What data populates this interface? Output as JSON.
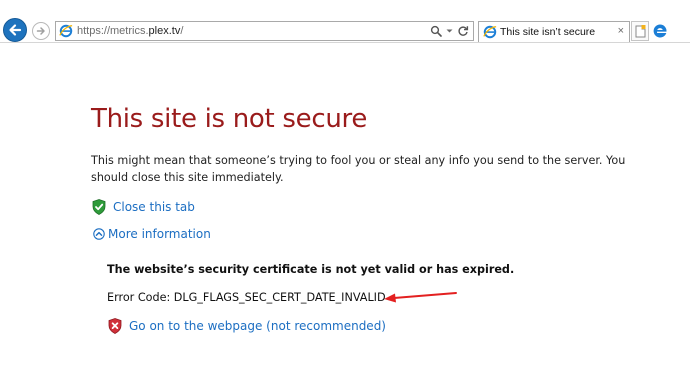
{
  "browser": {
    "url": "https://metrics.plex.tv/",
    "url_host": "plex.tv",
    "url_prefix": "https://metrics.",
    "url_suffix": "/",
    "tab_title": "This site isn’t secure",
    "tab_close_glyph": "×"
  },
  "page": {
    "title": "This site is not secure",
    "description": "This might mean that someone’s trying to fool you or steal any info you send to the server. You should close this site immediately.",
    "close_tab_label": "Close this tab",
    "more_info_label": "More information",
    "cert_heading": "The website’s security certificate is not yet valid or has expired.",
    "error_code_text": "Error Code: DLG_FLAGS_SEC_CERT_DATE_INVALID",
    "go_on_label": "Go on to the webpage (not recommended)"
  },
  "colors": {
    "title": "#9a1b1b",
    "link": "#1c6ec2",
    "annotation_arrow": "#e32020",
    "back_button": "#1e73be"
  },
  "icons": {
    "back": "back-arrow-icon",
    "forward": "forward-arrow-icon",
    "site": "ie-icon",
    "search": "search-icon",
    "refresh": "refresh-icon",
    "close_tab": "green-shield-icon",
    "more_info": "chevron-up-circle-icon",
    "go_on": "red-shield-icon",
    "new_tab": "new-tab-icon",
    "edge": "edge-icon"
  }
}
